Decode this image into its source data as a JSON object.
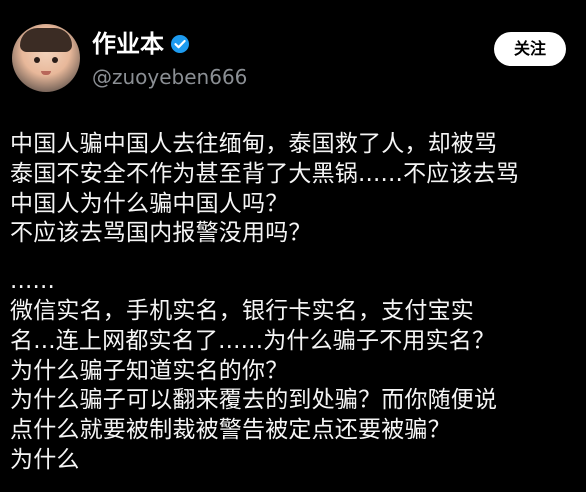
{
  "profile": {
    "display_name": "作业本",
    "handle": "@zuoyeben666",
    "verified_icon": "verified-badge-icon",
    "follow_label": "关注"
  },
  "post": {
    "lines": [
      "中国人骗中国人去往缅甸，泰国救了人，却被骂",
      "泰国不安全不作为甚至背了大黑锅......不应该去骂",
      "中国人为什么骗中国人吗？",
      "不应该去骂国内报警没用吗？",
      "",
      "......",
      "微信实名，手机实名，银行卡实名，支付宝实",
      "名...连上网都实名了......为什么骗子不用实名？",
      "为什么骗子知道实名的你？",
      "为什么骗子可以翻来覆去的到处骗？而你随便说",
      "点什么就要被制裁被警告被定点还要被骗？",
      "为什么"
    ]
  },
  "colors": {
    "background": "#000000",
    "text": "#f5f5f5",
    "handle": "#8b8f94",
    "verified": "#1d9bf0",
    "follow_bg": "#ffffff"
  }
}
